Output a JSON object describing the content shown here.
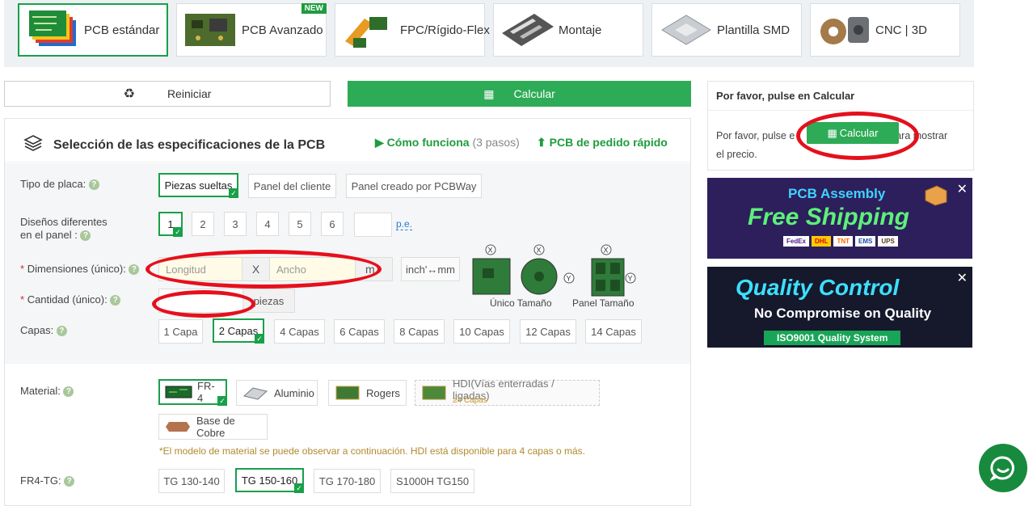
{
  "product_tabs": [
    {
      "label": "PCB estándar",
      "active": true
    },
    {
      "label": "PCB Avanzado",
      "badge": "NEW"
    },
    {
      "label": "FPC/Rígido-Flex"
    },
    {
      "label": "Montaje"
    },
    {
      "label": "Plantilla SMD"
    },
    {
      "label": "CNC | 3D"
    }
  ],
  "actions": {
    "reset_label": "Reiniciar",
    "calc_label": "Calcular"
  },
  "panel": {
    "title": "Selección de las especificaciones de la PCB",
    "how_label": "Cómo funciona",
    "how_steps": "(3 pasos)",
    "quick_label": "PCB de pedido rápido"
  },
  "board_type": {
    "label": "Tipo de placa:",
    "options": [
      "Piezas sueltas",
      "Panel del cliente",
      "Panel creado por PCBWay"
    ],
    "selected": "Piezas sueltas"
  },
  "designs": {
    "label_line1": "Diseños diferentes",
    "label_line2": "en el panel :",
    "options": [
      "1",
      "2",
      "3",
      "4",
      "5",
      "6"
    ],
    "selected": "1",
    "custom_value": "",
    "unit_link": "p.e."
  },
  "dimensions": {
    "required_mark": "*",
    "label": "Dimensiones (único):",
    "length_placeholder": "Longitud",
    "x_label": "X",
    "width_placeholder": "Ancho",
    "unit": "m",
    "convert_label": "inch'↔mm",
    "single_caption": "Único Tamaño",
    "panel_caption": "Panel Tamaño",
    "x_axis": "X",
    "y_axis": "Y"
  },
  "quantity": {
    "required_mark": "*",
    "label": "Cantidad (único):",
    "value": "",
    "unit": "piezas"
  },
  "layers": {
    "label": "Capas:",
    "options": [
      "1 Capa",
      "2 Capas",
      "4 Capas",
      "6 Capas",
      "8 Capas",
      "10 Capas",
      "12 Capas",
      "14 Capas"
    ],
    "selected": "2 Capas"
  },
  "material": {
    "label": "Material:",
    "options": [
      {
        "label": "FR-4",
        "selected": true
      },
      {
        "label": "Aluminio"
      },
      {
        "label": "Rogers"
      },
      {
        "label": "HDI(Vías enterradas / ligadas)",
        "sub": "≥4 Capas"
      },
      {
        "label": "Base de Cobre"
      }
    ],
    "note": "*El modelo de material se puede observar a continuación. HDI está disponible para 4 capas o más."
  },
  "tg": {
    "label": "FR4-TG:",
    "options": [
      "TG 130-140",
      "TG 150-160",
      "TG 170-180",
      "S1000H TG150"
    ],
    "selected": "TG 150-160"
  },
  "price_box": {
    "title": "Por favor, pulse en Calcular",
    "text_before": "Por favor, pulse e",
    "button_label": "Calcular",
    "text_after": "para mostrar",
    "text_line2": "el precio."
  },
  "banners": {
    "assembly_line1": "PCB Assembly",
    "assembly_line2": "Free Shipping",
    "carriers": [
      "FedEx",
      "DHL",
      "TNT",
      "EMS",
      "UPS"
    ],
    "quality_line1": "Quality Control",
    "quality_line2": "No Compromise on Quality",
    "quality_line3": "ISO9001 Quality System",
    "close_symbol": "✕"
  },
  "colors": {
    "brand_green": "#2eab56",
    "highlight_red": "#e5101c"
  }
}
